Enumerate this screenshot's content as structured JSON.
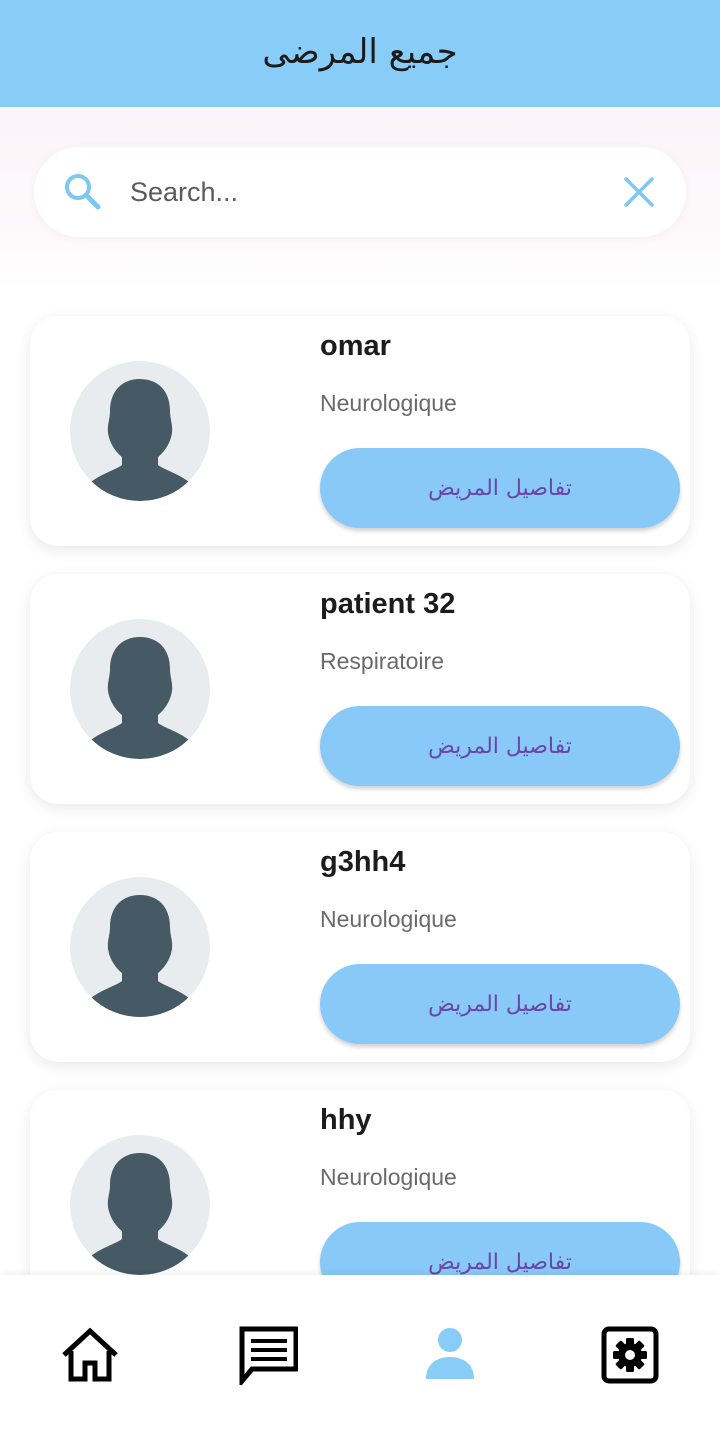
{
  "header": {
    "title": "جميع المرضى"
  },
  "search": {
    "placeholder": "Search...",
    "value": ""
  },
  "patients": [
    {
      "name": "omar",
      "specialty": "Neurologique",
      "button_label": "تفاصيل المريض"
    },
    {
      "name": "patient 32",
      "specialty": "Respiratoire",
      "button_label": "تفاصيل المريض"
    },
    {
      "name": "g3hh4",
      "specialty": "Neurologique",
      "button_label": "تفاصيل المريض"
    },
    {
      "name": "hhy",
      "specialty": "Neurologique",
      "button_label": "تفاصيل المريض"
    }
  ],
  "bottom_nav": [
    {
      "icon": "home-icon",
      "active": false
    },
    {
      "icon": "chat-icon",
      "active": false
    },
    {
      "icon": "person-icon",
      "active": true
    },
    {
      "icon": "settings-icon",
      "active": false
    }
  ],
  "colors": {
    "primary": "#88cdf7",
    "button": "#88c9f7",
    "button_text": "#6b45a8",
    "avatar_silhouette": "#455a64",
    "avatar_background": "#e9ecef"
  }
}
